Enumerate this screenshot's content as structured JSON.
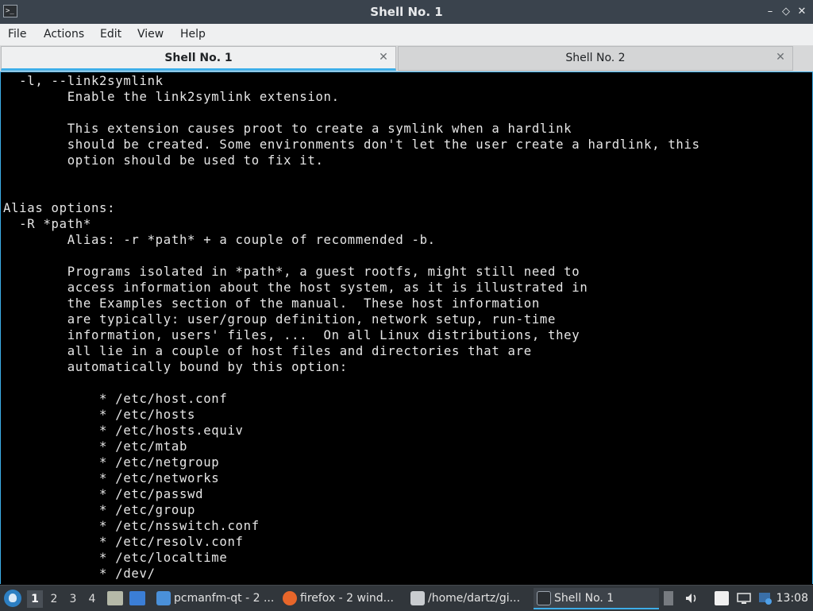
{
  "window": {
    "title": "Shell No. 1",
    "app_icon": ">_"
  },
  "menu": [
    "File",
    "Actions",
    "Edit",
    "View",
    "Help"
  ],
  "tabs": [
    {
      "label": "Shell No. 1",
      "active": true
    },
    {
      "label": "Shell No. 2",
      "active": false
    }
  ],
  "terminal": {
    "lines": [
      "  -l, --link2symlink",
      "        Enable the link2symlink extension.",
      "",
      "        This extension causes proot to create a symlink when a hardlink",
      "        should be created. Some environments don't let the user create a hardlink, this",
      "        option should be used to fix it.",
      "",
      "",
      "Alias options:",
      "  -R *path*",
      "        Alias: -r *path* + a couple of recommended -b.",
      "",
      "        Programs isolated in *path*, a guest rootfs, might still need to",
      "        access information about the host system, as it is illustrated in",
      "        the Examples section of the manual.  These host information",
      "        are typically: user/group definition, network setup, run-time",
      "        information, users' files, ...  On all Linux distributions, they",
      "        all lie in a couple of host files and directories that are",
      "        automatically bound by this option:",
      "",
      "            * /etc/host.conf",
      "            * /etc/hosts",
      "            * /etc/hosts.equiv",
      "            * /etc/mtab",
      "            * /etc/netgroup",
      "            * /etc/networks",
      "            * /etc/passwd",
      "            * /etc/group",
      "            * /etc/nsswitch.conf",
      "            * /etc/resolv.conf",
      "            * /etc/localtime",
      "            * /dev/"
    ]
  },
  "taskbar": {
    "desktops": [
      "1",
      "2",
      "3",
      "4"
    ],
    "current_desktop": "1",
    "tasks": [
      {
        "label": "pcmanfm-qt - 2 ...",
        "icon": "folder-icon",
        "color": "#4a90d9"
      },
      {
        "label": "firefox - 2 wind...",
        "icon": "firefox-icon",
        "color": "#e8662a"
      },
      {
        "label": "/home/dartz/gi...",
        "icon": "editor-icon",
        "color": "#c9ccd0"
      },
      {
        "label": "Shell No. 1",
        "icon": "terminal-icon",
        "color": "#2b2f33",
        "active": true
      }
    ],
    "clock": "13:08"
  },
  "colors": {
    "accent": "#3daee9",
    "terminal_bg": "#000000",
    "terminal_fg": "#e6e6e6",
    "titlebar": "#3a434d",
    "taskbar": "#31363b"
  }
}
